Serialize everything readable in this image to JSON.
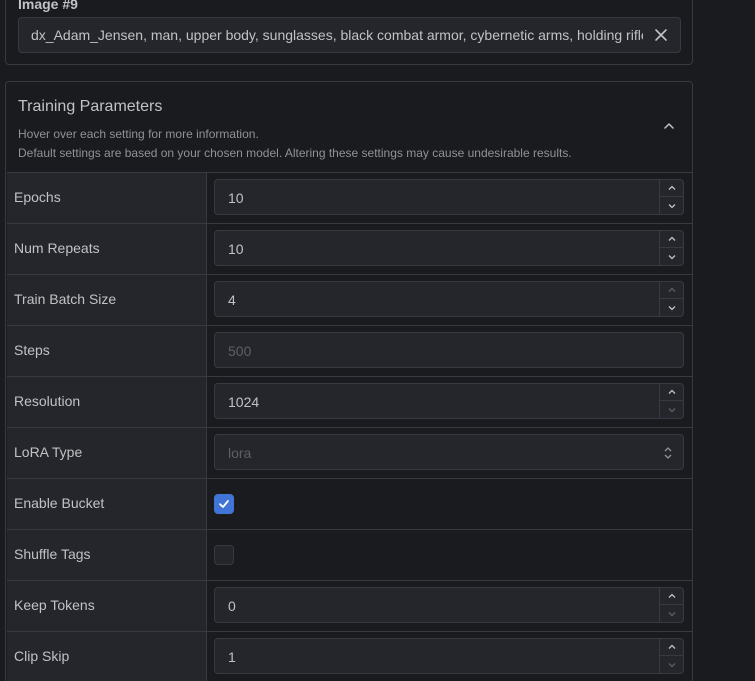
{
  "caption": {
    "label": "Image #9",
    "text": "dx_Adam_Jensen, man, upper body, sunglasses, black combat armor, cybernetic arms, holding rifle,"
  },
  "params": {
    "title": "Training Parameters",
    "hint1": "Hover over each setting for more information.",
    "hint2": "Default settings are based on your chosen model. Altering these settings may cause undesirable results.",
    "rows": {
      "epochs": {
        "label": "Epochs",
        "value": "10"
      },
      "num_repeats": {
        "label": "Num Repeats",
        "value": "10"
      },
      "train_batch_size": {
        "label": "Train Batch Size",
        "value": "4"
      },
      "steps": {
        "label": "Steps",
        "value": "500"
      },
      "resolution": {
        "label": "Resolution",
        "value": "1024"
      },
      "lora_type": {
        "label": "LoRA Type",
        "value": "lora"
      },
      "enable_bucket": {
        "label": "Enable Bucket",
        "checked": true
      },
      "shuffle_tags": {
        "label": "Shuffle Tags",
        "checked": false
      },
      "keep_tokens": {
        "label": "Keep Tokens",
        "value": "0"
      },
      "clip_skip": {
        "label": "Clip Skip",
        "value": "1"
      }
    }
  },
  "colors": {
    "background": "#1a1b1e",
    "surface": "#25262b",
    "border": "#373a40",
    "accent": "#4074d6"
  }
}
